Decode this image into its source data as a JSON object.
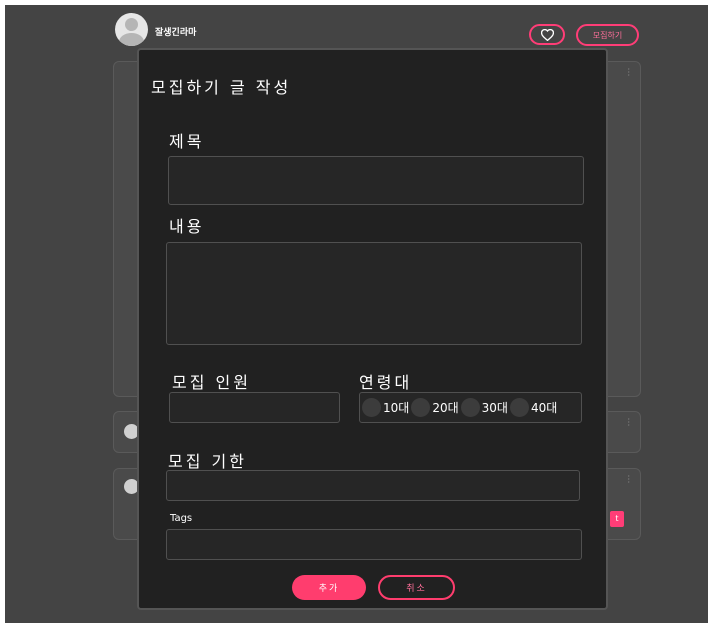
{
  "header": {
    "username": "잘생긴라마",
    "recruit_button": "모집하기"
  },
  "cards": {
    "tag_text": "t"
  },
  "modal": {
    "title": "모집하기 글 작성",
    "title_label": "제목",
    "content_label": "내용",
    "headcount_label": "모집 인원",
    "age_label": "연령대",
    "age_options": [
      "10대",
      "20대",
      "30대",
      "40대"
    ],
    "deadline_label": "모집 기한",
    "tags_label": "Tags",
    "add_button": "추가",
    "cancel_button": "취소"
  },
  "colors": {
    "accent": "#ff3d77",
    "background": "#444444",
    "modal_background": "#212121"
  }
}
